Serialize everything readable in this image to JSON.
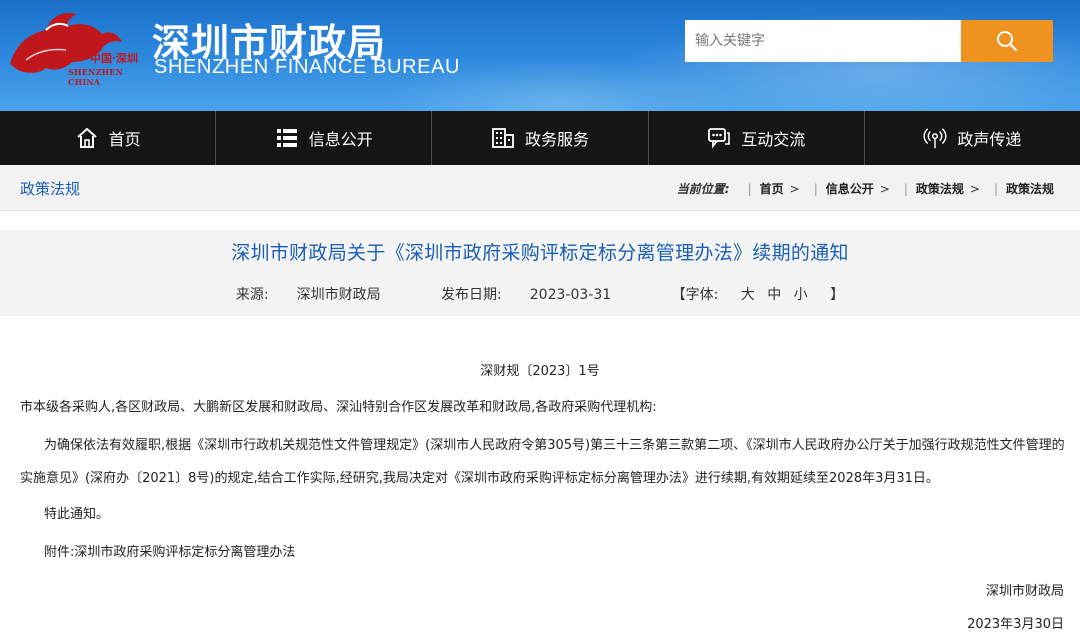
{
  "header": {
    "logo_cn": "中国·深圳",
    "logo_en": "SHENZHEN CHINA",
    "title": "深圳市财政局",
    "subtitle": "SHENZHEN FINANCE BUREAU",
    "search_placeholder": "输入关键字",
    "search_icon": "search-icon",
    "accent_color": "#f0921e"
  },
  "nav": {
    "items": [
      {
        "label": "首页",
        "icon": "home-icon"
      },
      {
        "label": "信息公开",
        "icon": "list-icon"
      },
      {
        "label": "政务服务",
        "icon": "building-icon"
      },
      {
        "label": "互动交流",
        "icon": "chat-icon"
      },
      {
        "label": "政声传递",
        "icon": "broadcast-icon"
      }
    ]
  },
  "breadcrumb": {
    "section": "政策法规",
    "label": "当前位置:",
    "items": [
      "首页",
      "信息公开",
      "政策法规",
      "政策法规"
    ]
  },
  "article": {
    "title": "深圳市财政局关于《深圳市政府采购评标定标分离管理办法》续期的通知",
    "source_label": "来源:",
    "source": "深圳市财政局",
    "date_label": "发布日期:",
    "date": "2023-03-31",
    "font_label": "【字体:",
    "font_large": "大",
    "font_medium": "中",
    "font_small": "小",
    "font_close": "】",
    "doc_number": "深财规〔2023〕1号",
    "recipients": "市本级各采购人,各区财政局、大鹏新区发展和财政局、深汕特别合作区发展改革和财政局,各政府采购代理机构:",
    "body": "为确保依法有效履职,根据《深圳市行政机关规范性文件管理规定》(深圳市人民政府令第305号)第三十三条第三款第二项、《深圳市人民政府办公厅关于加强行政规范性文件管理的实施意见》(深府办〔2021〕8号)的规定,结合工作实际,经研究,我局决定对《深圳市政府采购评标定标分离管理办法》进行续期,有效期延续至2028年3月31日。",
    "notice": "特此通知。",
    "attachment": "附件:深圳市政府采购评标定标分离管理办法",
    "signature": "深圳市财政局",
    "sign_date": "2023年3月30日"
  }
}
